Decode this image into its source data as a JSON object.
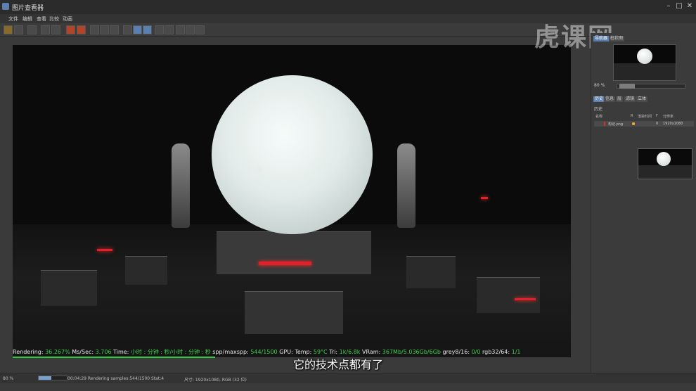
{
  "window": {
    "title": "图片查看器",
    "minimize": "–",
    "maximize": "□",
    "close": "✕"
  },
  "menu": [
    "文件",
    "编辑",
    "查看",
    "比较",
    "动画"
  ],
  "toolbar_icons": [
    "open-icon",
    "save-icon",
    "info-icon",
    "copy-icon",
    "render-icon",
    "history-icon",
    "stop-icon",
    "region-icon",
    "layout-icon",
    "grid-icon",
    "compare-icon",
    "fit-icon",
    "zoom-icon",
    "channel-icon"
  ],
  "viewport": {
    "render_status": {
      "rendering_label": "Rendering:",
      "rendering_value": "36.267%",
      "ms_label": "Ms/Sec:",
      "ms_value": "3.706",
      "time_label": "Time:",
      "time_value": "小时 : 分钟 : 秒/小时 : 分钟 : 秒",
      "spp_label": "spp/maxspp:",
      "spp_value": "544/1500",
      "gpu_label": "GPU:",
      "temp_label": "Temp:",
      "temp_value": "59°C",
      "tri_label": "Tri:",
      "tri_value": "1k/6.8k",
      "vram_label": "VRam:",
      "vram_value": "367Mb/5.036Gb/6Gb",
      "grey_label": "grey8/16:",
      "grey_value": "0/0",
      "rgb_label": "rgb32/64:",
      "rgb_value": "1/1"
    }
  },
  "subtitle": "它的技术点都有了",
  "watermark": "虎课网",
  "bottombar": {
    "zoom": "80 %",
    "progress_fraction": 0.45,
    "status": "00:04:29 Rendering samples:544/1500 Stat:4",
    "size_info": "尺寸: 1920x1080, RGB (32 位)"
  },
  "right_panel": {
    "tabs": [
      "导航器",
      "柱状图"
    ],
    "zoom": "80 %",
    "tabs2": [
      "历史",
      "信息",
      "层",
      "滤镜",
      "立体"
    ],
    "section_label": "历史",
    "headers": [
      "名称",
      "R",
      "渲染时间",
      "F",
      "分辨率"
    ],
    "row": {
      "name": "构记.png",
      "render_time": "0",
      "resolution": "1920x1080"
    }
  },
  "colors": {
    "accent": "#5b7fae",
    "status_green": "#3dd24a",
    "red_light": "#e0202a"
  }
}
